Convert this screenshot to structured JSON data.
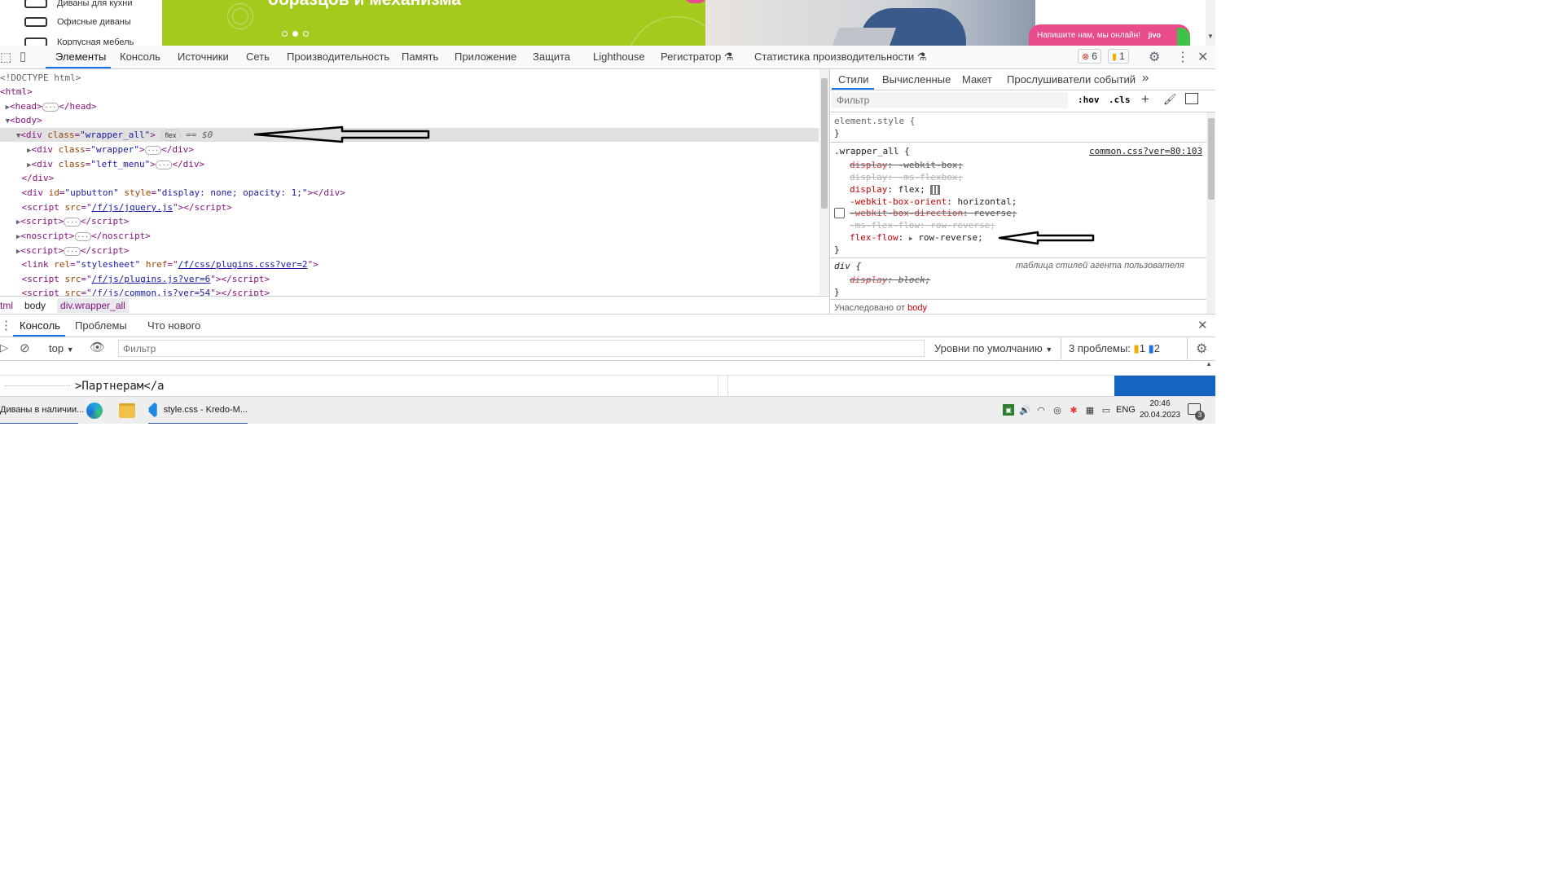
{
  "page": {
    "menu_items": [
      "Диваны для кухни",
      "Офисные диваны",
      "Корпусная мебель"
    ],
    "banner_title": "образцов и механизма",
    "jivo_label": "Напишите нам, мы онлайн!",
    "jivo_logo": "jivo",
    "slider_active_index": 1
  },
  "devtools": {
    "tabs": [
      "Элементы",
      "Консоль",
      "Источники",
      "Сеть",
      "Производительность",
      "Память",
      "Приложение",
      "Защита",
      "Lighthouse",
      "Регистратор",
      "Статистика производительности"
    ],
    "active_tab": "Элементы",
    "error_count": "6",
    "warning_count": "1",
    "icons": [
      "inspect-icon",
      "device-toolbar-icon",
      "settings-gear-icon",
      "more-vertical-icon",
      "close-icon"
    ]
  },
  "elements": {
    "doctype": "<!DOCTYPE html>",
    "html_open": "<html>",
    "head": "<head>",
    "head_close": "</head>",
    "body_open": "<body>",
    "wrapper_all_open": "<div class=",
    "wrapper_all_class": "\"wrapper_all\"",
    "wrapper_all_badge": "flex",
    "wrapper_all_dollar": "== $0",
    "wrapper_class": "\"wrapper\"",
    "left_menu_class": "\"left_menu\"",
    "div_close": "</div>",
    "upbutton_id": "\"upbutton\"",
    "upbutton_style": "\"display: none; opacity: 1;\"",
    "jquery_src": "/f/js/jquery.js",
    "plugins_css_href": "/f/css/plugins.css?ver=2",
    "plugins_js_src": "/f/js/plugins.js?ver=6",
    "common_js_src": "/f/js/common.js?ver=54"
  },
  "breadcrumb": [
    "tml",
    "body",
    "div.wrapper_all"
  ],
  "styles": {
    "tabs": [
      "Стили",
      "Вычисленные",
      "Макет",
      "Прослушиватели событий"
    ],
    "active_tab": "Стили",
    "filter_placeholder": "Фильтр",
    "hov": ":hov",
    "cls": ".cls",
    "element_style": "element.style {",
    "rule_selector": ".wrapper_all {",
    "rule_source": "common.css?ver=80:103",
    "declarations": [
      {
        "prop": "display",
        "value": "-webkit-box;",
        "struck": true
      },
      {
        "prop": "display",
        "value": "-ms-flexbox;",
        "struck": true
      },
      {
        "prop": "display",
        "value": "flex;",
        "struck": false
      },
      {
        "prop": "-webkit-box-orient",
        "value": "horizontal;",
        "struck": false
      },
      {
        "prop": "-webkit-box-direction",
        "value": "reverse;",
        "struck": true
      },
      {
        "prop": "-ms-flex-flow",
        "value": "row-reverse;",
        "struck": true
      },
      {
        "prop": "flex-flow",
        "value": "row-reverse;",
        "struck": false
      }
    ],
    "ua_selector": "div {",
    "ua_source": "таблица стилей агента пользователя",
    "ua_decl_prop": "display",
    "ua_decl_value": "block;",
    "inherited_label": "Унаследовано от",
    "inherited_from": "body"
  },
  "drawer": {
    "tabs": [
      "Консоль",
      "Проблемы",
      "Что нового"
    ],
    "active_tab": "Консоль",
    "context": "top",
    "filter_placeholder": "Фильтр",
    "levels": "Уровни по умолчанию",
    "issues_label": "3 проблемы:",
    "issues_warn": "1",
    "issues_info": "2"
  },
  "editor": {
    "code_line": ">Партнерам</a"
  },
  "taskbar": {
    "browser_item": "Диваны в наличии...",
    "vscode_item": "style.css - Kredo-M...",
    "lang": "ENG",
    "time": "20:46",
    "date": "20.04.2023",
    "notifications": "3"
  },
  "colors": {
    "banner_green": "#a6c91e",
    "jivo_pink": "#e84c8b",
    "accent_blue": "#1a73e8",
    "error_red": "#d93025",
    "warning_orange": "#f9ab00"
  }
}
